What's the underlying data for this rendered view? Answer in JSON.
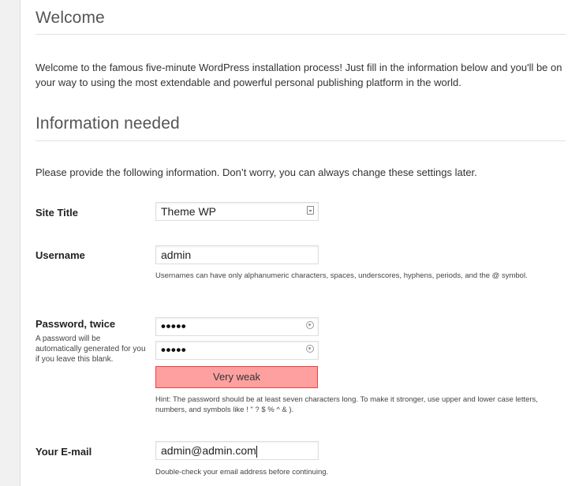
{
  "welcome": {
    "heading": "Welcome",
    "text": "Welcome to the famous five-minute WordPress installation process! Just fill in the information below and you'll be on your way to using the most extendable and powerful personal publishing platform in the world."
  },
  "info": {
    "heading": "Information needed",
    "text": "Please provide the following information. Don’t worry, you can always change these settings later."
  },
  "form": {
    "site_title": {
      "label": "Site Title",
      "value": "Theme WP"
    },
    "username": {
      "label": "Username",
      "value": "admin",
      "hint": "Usernames can have only alphanumeric characters, spaces, underscores, hyphens, periods, and the @ symbol."
    },
    "password": {
      "label": "Password, twice",
      "description": "A password will be automatically generated for you if you leave this blank.",
      "value1": "•••••",
      "value2": "•••••",
      "strength": "Very weak",
      "hint": "Hint: The password should be at least seven characters long. To make it stronger, use upper and lower case letters, numbers, and symbols like ! \" ? $ % ^ & )."
    },
    "email": {
      "label": "Your E-mail",
      "value": "admin@admin.com",
      "hint": "Double-check your email address before continuing."
    }
  },
  "colors": {
    "strength_bg": "#ffa0a0",
    "strength_border": "#f04040"
  }
}
